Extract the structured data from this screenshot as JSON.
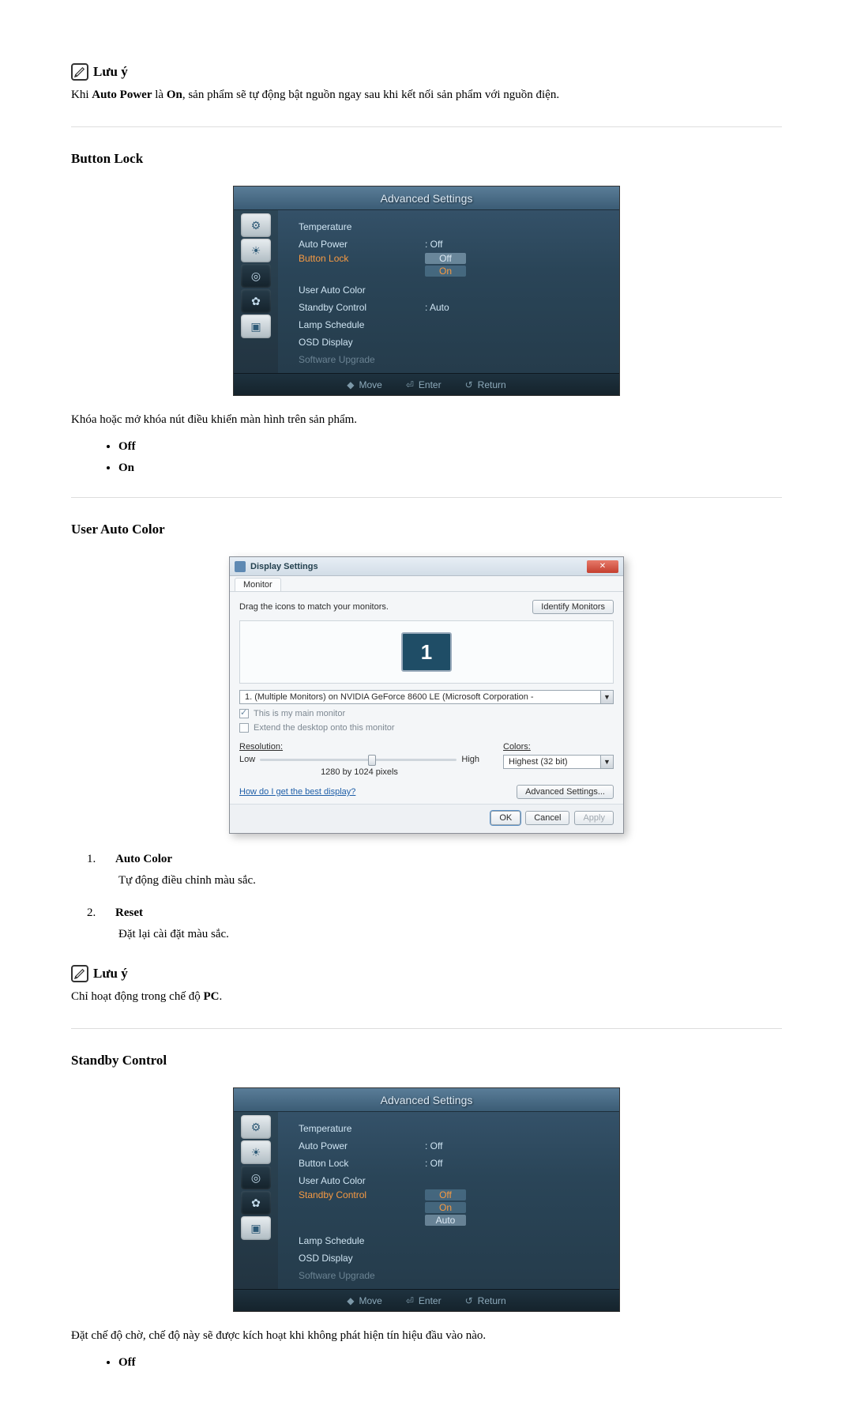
{
  "note1": {
    "title": "Lưu ý",
    "body_prefix": "Khi ",
    "body_term1": "Auto Power",
    "body_mid": " là ",
    "body_term2": "On",
    "body_suffix": ", sản phẩm sẽ tự động bật nguồn ngay sau khi kết nối sản phẩm với nguồn điện."
  },
  "button_lock": {
    "heading": "Button Lock",
    "osd_title": "Advanced Settings",
    "rows": [
      {
        "label": "Temperature",
        "val": ""
      },
      {
        "label": "Auto Power",
        "val": ": Off"
      },
      {
        "label": "Button Lock",
        "val": "",
        "active": true,
        "options": [
          "Off",
          "On"
        ],
        "sel": 0
      },
      {
        "label": "User Auto Color",
        "val": ""
      },
      {
        "label": "Standby Control",
        "val": ": Auto"
      },
      {
        "label": "Lamp Schedule",
        "val": ""
      },
      {
        "label": "OSD Display",
        "val": ""
      },
      {
        "label": "Software Upgrade",
        "val": "",
        "muted": true
      }
    ],
    "footer": {
      "move": "Move",
      "enter": "Enter",
      "ret": "Return"
    },
    "desc": "Khóa hoặc mở khóa nút điều khiển màn hình trên sản phẩm.",
    "opts": [
      "Off",
      "On"
    ]
  },
  "user_auto_color": {
    "heading": "User Auto Color",
    "dlg": {
      "title": "Display Settings",
      "tab": "Monitor",
      "instr": "Drag the icons to match your monitors.",
      "identify": "Identify Monitors",
      "monitor_dd": "1. (Multiple Monitors) on NVIDIA GeForce 8600 LE (Microsoft Corporation - ",
      "main_chk": "This is my main monitor",
      "extend_chk": "Extend the desktop onto this monitor",
      "res_label": "Resolution:",
      "low": "Low",
      "high": "High",
      "res_text": "1280 by 1024 pixels",
      "colors_label": "Colors:",
      "colors_val": "Highest (32 bit)",
      "help": "How do I get the best display?",
      "advanced": "Advanced Settings...",
      "ok": "OK",
      "cancel": "Cancel",
      "apply": "Apply"
    },
    "items": [
      {
        "label": "Auto Color",
        "desc": "Tự động điều chỉnh màu sắc."
      },
      {
        "label": "Reset",
        "desc": "Đặt lại cài đặt màu sắc."
      }
    ]
  },
  "note2": {
    "title": "Lưu ý",
    "body_prefix": "Chỉ hoạt động trong chế độ ",
    "body_term": "PC",
    "body_suffix": "."
  },
  "standby_control": {
    "heading": "Standby Control",
    "osd_title": "Advanced Settings",
    "rows": [
      {
        "label": "Temperature",
        "val": ""
      },
      {
        "label": "Auto Power",
        "val": ": Off"
      },
      {
        "label": "Button Lock",
        "val": ": Off"
      },
      {
        "label": "User Auto Color",
        "val": ""
      },
      {
        "label": "Standby Control",
        "val": "",
        "active": true,
        "options": [
          "Off",
          "On",
          "Auto"
        ],
        "sel": 2
      },
      {
        "label": "Lamp Schedule",
        "val": ""
      },
      {
        "label": "OSD Display",
        "val": ""
      },
      {
        "label": "Software Upgrade",
        "val": "",
        "muted": true
      }
    ],
    "footer": {
      "move": "Move",
      "enter": "Enter",
      "ret": "Return"
    },
    "desc": "Đặt chế độ chờ, chế độ này sẽ được kích hoạt khi không phát hiện tín hiệu đầu vào nào.",
    "opts": [
      "Off"
    ]
  }
}
